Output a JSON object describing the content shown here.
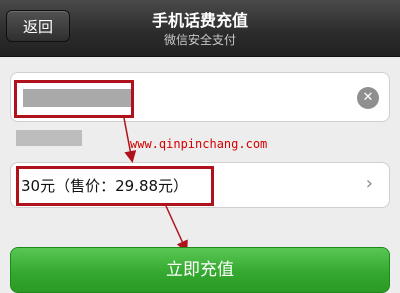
{
  "header": {
    "back_label": "返回",
    "title": "手机话费充值",
    "subtitle": "微信安全支付"
  },
  "phone_input": {
    "clear_icon": "clear-icon"
  },
  "amount_select": {
    "selected": "30元（售价：29.88元）",
    "chevron_icon": "chevron-right-icon"
  },
  "watermark": "www.qinpinchang.com",
  "submit_label": "立即充值",
  "colors": {
    "nav_bg": "#2b2b2b",
    "annotation_red": "#b0121b",
    "watermark_red": "#d40000",
    "primary_green": "#35a92f"
  }
}
